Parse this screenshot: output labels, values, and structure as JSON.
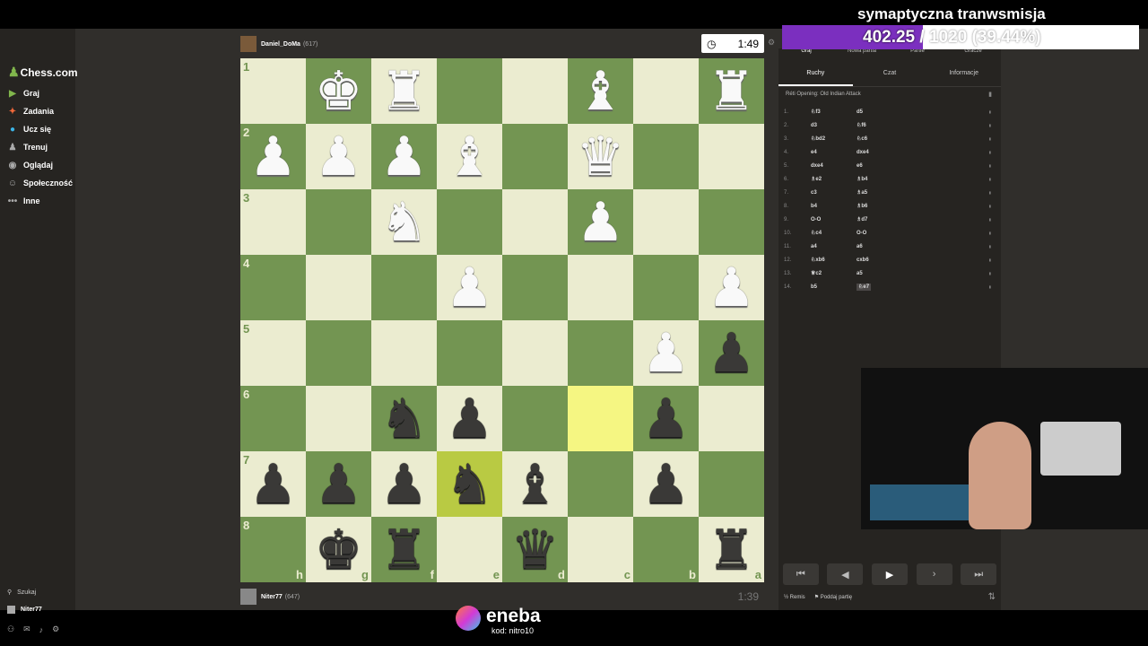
{
  "stream": {
    "title": "symaptyczna tranwsmisja",
    "goal_current": "402.25",
    "goal_rest": "/ 1020 (39.44%)",
    "goal_progress": 0.3944,
    "sponsor_name": "eneba",
    "sponsor_code": "kod: nitro10"
  },
  "sidebar": {
    "logo": "Chess.com",
    "items": [
      {
        "label": "Graj",
        "icon": "play-icon",
        "glyph": "▶",
        "color": "#81b64c"
      },
      {
        "label": "Zadania",
        "icon": "puzzle-icon",
        "glyph": "✦",
        "color": "#f0683a"
      },
      {
        "label": "Ucz się",
        "icon": "learn-icon",
        "glyph": "●",
        "color": "#3cb4e6"
      },
      {
        "label": "Trenuj",
        "icon": "train-icon",
        "glyph": "♟",
        "color": "#aaaaaa"
      },
      {
        "label": "Oglądaj",
        "icon": "watch-icon",
        "glyph": "◉",
        "color": "#aaaaaa"
      },
      {
        "label": "Społeczność",
        "icon": "community-icon",
        "glyph": "☺",
        "color": "#aaaaaa"
      },
      {
        "label": "Inne",
        "icon": "more-icon",
        "glyph": "•••",
        "color": "#aaaaaa"
      }
    ],
    "search_label": "Szukaj",
    "user_label": "Niter77"
  },
  "top_player": {
    "name": "Daniel_DoMa",
    "rating": "(617)",
    "clock": "1:49"
  },
  "bottom_player": {
    "name": "Niter77",
    "rating": "(647)",
    "clock": "1:39"
  },
  "board": {
    "ranks": [
      "1",
      "2",
      "3",
      "4",
      "5",
      "6",
      "7",
      "8"
    ],
    "files": [
      "h",
      "g",
      "f",
      "e",
      "d",
      "c",
      "b",
      "a"
    ],
    "rows": [
      [
        "",
        "wK",
        "wR",
        "",
        "",
        "wB",
        "",
        "wR"
      ],
      [
        "wP",
        "wP",
        "wP",
        "wB",
        "",
        "wQ",
        "",
        ""
      ],
      [
        "",
        "",
        "wN",
        "",
        "",
        "wP",
        "",
        ""
      ],
      [
        "",
        "",
        "",
        "wP",
        "",
        "",
        "",
        "wP"
      ],
      [
        "",
        "",
        "",
        "",
        "",
        "",
        "wP",
        "bP"
      ],
      [
        "",
        "",
        "bN",
        "bP",
        "",
        "",
        "bP",
        ""
      ],
      [
        "bP",
        "bP",
        "bP",
        "bN",
        "bB",
        "",
        "bP",
        ""
      ],
      [
        "",
        "bK",
        "bR",
        "",
        "bQ",
        "",
        "",
        "bR"
      ]
    ],
    "highlights": [
      [
        5,
        5
      ],
      [
        6,
        3
      ]
    ]
  },
  "panel": {
    "top_tabs": [
      "Graj",
      "Nowa partia",
      "Partie",
      "Gracze"
    ],
    "sub_tabs": [
      "Ruchy",
      "Czat",
      "Informacje"
    ],
    "opening": "Réti Opening: Old Indian Attack",
    "moves": [
      {
        "n": "1.",
        "w": "♘f3",
        "b": "d5"
      },
      {
        "n": "2.",
        "w": "d3",
        "b": "♘f6"
      },
      {
        "n": "3.",
        "w": "♘bd2",
        "b": "♘c6"
      },
      {
        "n": "4.",
        "w": "e4",
        "b": "dxe4"
      },
      {
        "n": "5.",
        "w": "dxe4",
        "b": "e6"
      },
      {
        "n": "6.",
        "w": "♗e2",
        "b": "♗b4"
      },
      {
        "n": "7.",
        "w": "c3",
        "b": "♗a5"
      },
      {
        "n": "8.",
        "w": "b4",
        "b": "♗b6"
      },
      {
        "n": "9.",
        "w": "O-O",
        "b": "♗d7"
      },
      {
        "n": "10.",
        "w": "♘c4",
        "b": "O-O"
      },
      {
        "n": "11.",
        "w": "a4",
        "b": "a6"
      },
      {
        "n": "12.",
        "w": "♘xb6",
        "b": "cxb6"
      },
      {
        "n": "13.",
        "w": "♕c2",
        "b": "a5"
      },
      {
        "n": "14.",
        "w": "b5",
        "b": "♘e7"
      }
    ],
    "draw_label": "Remis",
    "resign_label": "Poddaj partię"
  }
}
